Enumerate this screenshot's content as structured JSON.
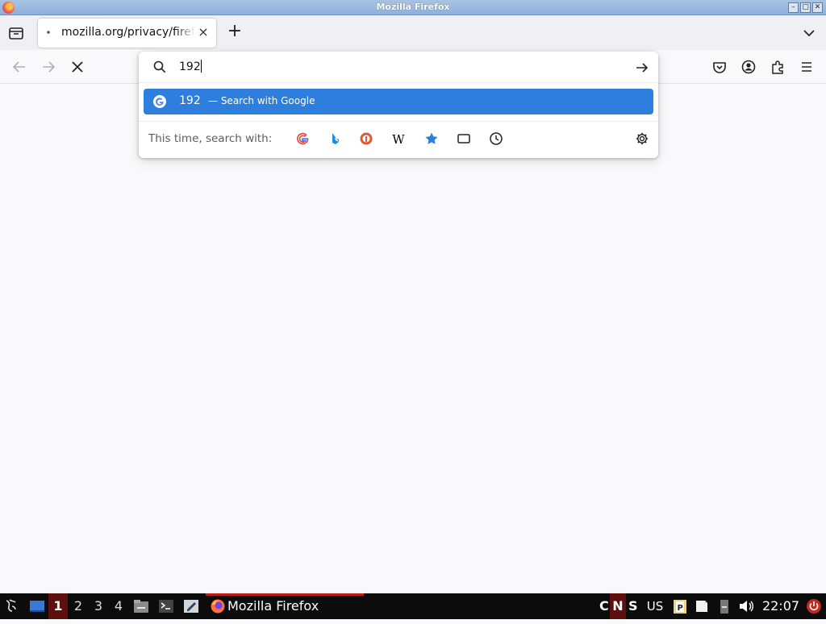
{
  "window": {
    "title": "Mozilla Firefox",
    "min": "–",
    "max": "▢",
    "close": "✕"
  },
  "tabs": [
    {
      "title": "mozilla.org/privacy/firefox/",
      "close": "×"
    }
  ],
  "newtab": "+",
  "urlbar": {
    "value": "192",
    "result": {
      "query": "192",
      "action": "— Search with Google"
    },
    "oneoff_label": "This time, search with:",
    "engines": [
      "google-icon",
      "bing-icon",
      "duckduckgo-icon",
      "wikipedia-icon",
      "bookmarks-icon",
      "tabs-icon",
      "history-icon"
    ],
    "wikipedia_glyph": "W"
  },
  "taskbar": {
    "workspaces": [
      "1",
      "2",
      "3",
      "4"
    ],
    "active_workspace": "1",
    "task_label": "Mozilla Firefox",
    "indicators": {
      "caps": "C",
      "num": "N",
      "scroll": "S"
    },
    "layout": "US",
    "clock": "22:07"
  },
  "colors": {
    "accent": "#2e7fdd",
    "taskbar": "#0c0c0c",
    "workspace_active": "#5d0e0e"
  }
}
